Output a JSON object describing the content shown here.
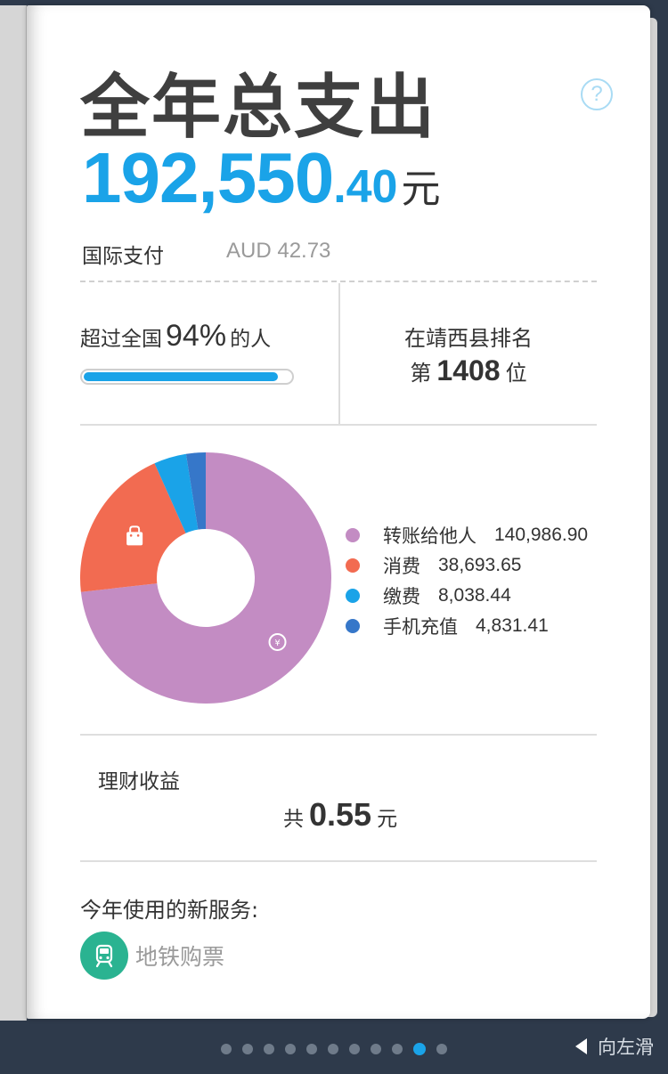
{
  "header": {
    "title": "全年总支出",
    "help_glyph": "?",
    "total_integer": "192,550",
    "total_decimal": ".40",
    "total_unit": "元"
  },
  "international": {
    "label": "国际支付",
    "value": "AUD 42.73"
  },
  "beat": {
    "prefix": "超过全国",
    "percent": "94%",
    "suffix": "的人",
    "progress_fraction": 0.94
  },
  "rank": {
    "title": "在靖西县排名",
    "prefix": "第",
    "number": "1408",
    "suffix": "位"
  },
  "chart_data": {
    "type": "pie",
    "categories": [
      "转账给他人",
      "消费",
      "缴费",
      "手机充值"
    ],
    "values": [
      140986.9,
      38693.65,
      8038.44,
      4831.41
    ],
    "display_values": [
      "140,986.90",
      "38,693.65",
      "8,038.44",
      "4,831.41"
    ],
    "colors": [
      "#c38cc3",
      "#f26b51",
      "#1aa3e8",
      "#3677c9"
    ],
    "icons": [
      "yuan-transfer-icon",
      "shopping-bag-icon",
      "",
      ""
    ],
    "legend_position": "right"
  },
  "wealth": {
    "label": "理财收益",
    "prefix": "共",
    "amount": "0.55",
    "unit": "元"
  },
  "new_services": {
    "title": "今年使用的新服务:",
    "items": [
      {
        "label": "地铁购票",
        "icon": "subway-train-icon",
        "color": "#2ab391"
      }
    ]
  },
  "pager": {
    "count": 11,
    "active_index": 9,
    "swipe_label": "向左滑"
  }
}
